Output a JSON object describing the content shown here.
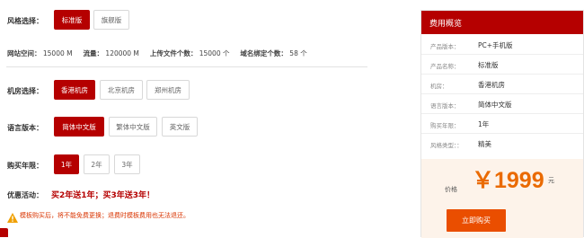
{
  "style_row": {
    "label": "风格选择：",
    "options": [
      "标准版",
      "旗舰版"
    ],
    "selected": 0
  },
  "stats": {
    "space_label": "网站空间：",
    "space_value": "15000 M",
    "traffic_label": "流量：",
    "traffic_value": "120000 M",
    "files_label": "上传文件个数：",
    "files_value": "15000 个",
    "domains_label": "域名绑定个数：",
    "domains_value": "58 个"
  },
  "room_row": {
    "label": "机房选择：",
    "options": [
      "香港机房",
      "北京机房",
      "郑州机房"
    ],
    "selected": 0
  },
  "lang_row": {
    "label": "语言版本：",
    "options": [
      "简体中文版",
      "繁体中文版",
      "英文版"
    ],
    "selected": 0
  },
  "year_row": {
    "label": "购买年限：",
    "options": [
      "1年",
      "2年",
      "3年"
    ],
    "selected": 0
  },
  "promo": {
    "label": "优惠活动：",
    "text": "买2年送1年；买3年送3年！"
  },
  "warning": {
    "text": "模板购买后，将不能免费更换；退费时模板费用也无法退还。"
  },
  "summary": {
    "title": "费用概览",
    "rows": [
      {
        "key": "产品版本：",
        "value": "PC+手机版"
      },
      {
        "key": "产品名称：",
        "value": "标准版"
      },
      {
        "key": "机房：",
        "value": "香港机房"
      },
      {
        "key": "语言版本：",
        "value": "简体中文版"
      },
      {
        "key": "购买年限：",
        "value": "1年"
      },
      {
        "key": "风格类型：：",
        "value": "精美"
      }
    ],
    "price_label": "价格",
    "price": "￥1999",
    "unit": "元",
    "buy_label": "立即购买"
  },
  "colors": {
    "brand": "#b50000",
    "buy_button": "#ea4e00",
    "price": "#ea6a00"
  }
}
